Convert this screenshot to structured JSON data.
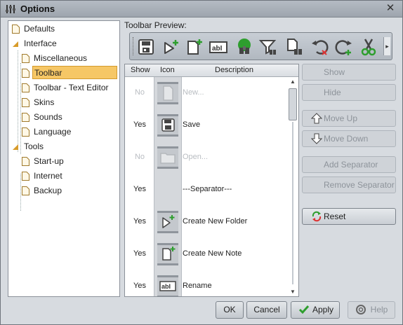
{
  "window": {
    "title": "Options",
    "close_symbol": "✕"
  },
  "tree": {
    "items": [
      {
        "label": "Defaults"
      },
      {
        "label": "Interface"
      },
      {
        "label": "Miscellaneous"
      },
      {
        "label": "Toolbar"
      },
      {
        "label": "Toolbar - Text Editor"
      },
      {
        "label": "Skins"
      },
      {
        "label": "Sounds"
      },
      {
        "label": "Language"
      },
      {
        "label": "Tools"
      },
      {
        "label": "Start-up"
      },
      {
        "label": "Internet"
      },
      {
        "label": "Backup"
      }
    ],
    "selected": "Toolbar"
  },
  "preview": {
    "label": "Toolbar Preview:",
    "icons": [
      "save-icon",
      "new-folder-icon",
      "new-note-icon",
      "rename-icon",
      "find-icon",
      "filter-icon",
      "find-file-icon",
      "undo-icon",
      "redo-icon",
      "cut-icon"
    ],
    "more_symbol": "▸"
  },
  "list": {
    "headers": {
      "show": "Show",
      "icon": "Icon",
      "description": "Description"
    },
    "rows": [
      {
        "show": "No",
        "description": "New...",
        "icon": "new-file-icon",
        "disabled": true
      },
      {
        "show": "Yes",
        "description": "Save",
        "icon": "save-icon",
        "disabled": false
      },
      {
        "show": "No",
        "description": "Open...",
        "icon": "folder-icon",
        "disabled": true
      },
      {
        "show": "Yes",
        "description": "---Separator---",
        "icon": "",
        "disabled": false
      },
      {
        "show": "Yes",
        "description": "Create New Folder",
        "icon": "new-folder-icon",
        "disabled": false
      },
      {
        "show": "Yes",
        "description": "Create New Note",
        "icon": "new-note-icon",
        "disabled": false
      },
      {
        "show": "Yes",
        "description": "Rename",
        "icon": "rename-icon",
        "disabled": false
      }
    ]
  },
  "side_buttons": {
    "show": "Show",
    "hide": "Hide",
    "move_up": "Move Up",
    "move_down": "Move Down",
    "add_separator": "Add Separator",
    "remove_separator": "Remove Separator",
    "reset": "Reset"
  },
  "bottom_buttons": {
    "ok": "OK",
    "cancel": "Cancel",
    "apply": "Apply",
    "help": "Help"
  },
  "colors": {
    "selection": "#f6c766",
    "window_bg": "#d7dbe0",
    "accent_green": "#2e9e2e"
  }
}
